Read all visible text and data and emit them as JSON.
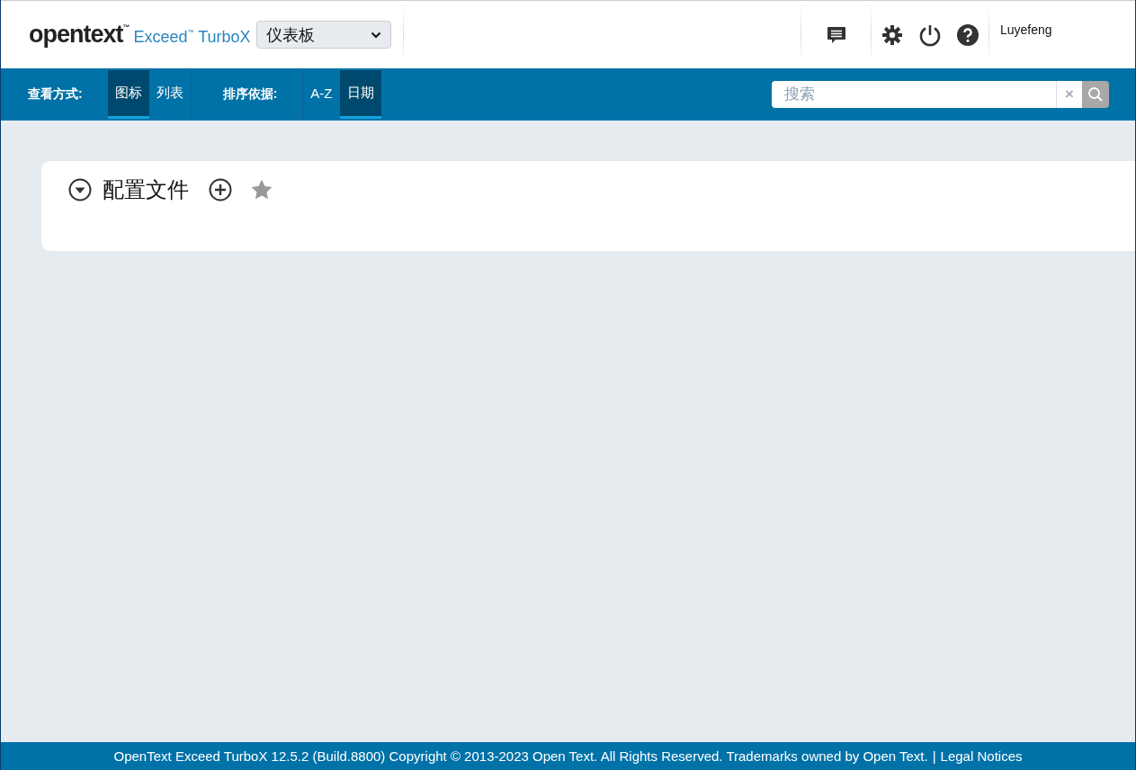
{
  "header": {
    "brand": "opentext$^{™}$",
    "product": "Exceed$^{™}$ TurboX",
    "view_select": {
      "value": "仪表板"
    },
    "user": "Luyefeng"
  },
  "toolbar": {
    "view_label": "查看方式:",
    "view_options": [
      {
        "label": "图标",
        "selected": true
      },
      {
        "label": "列表",
        "selected": false
      }
    ],
    "sort_label": "排序依据:",
    "sort_options": [
      {
        "label": "A-Z",
        "selected": false
      },
      {
        "label": "日期",
        "selected": true
      }
    ],
    "search": {
      "placeholder": "搜索",
      "clear": "×"
    }
  },
  "section": {
    "title": "配置文件"
  },
  "footer": {
    "text": "OpenText Exceed TurboX 12.5.2 (Build.8800) Copyright © 2013-2023 Open Text. All Rights Reserved. Trademarks owned by Open Text.",
    "separator": "|",
    "link": "Legal Notices"
  }
}
